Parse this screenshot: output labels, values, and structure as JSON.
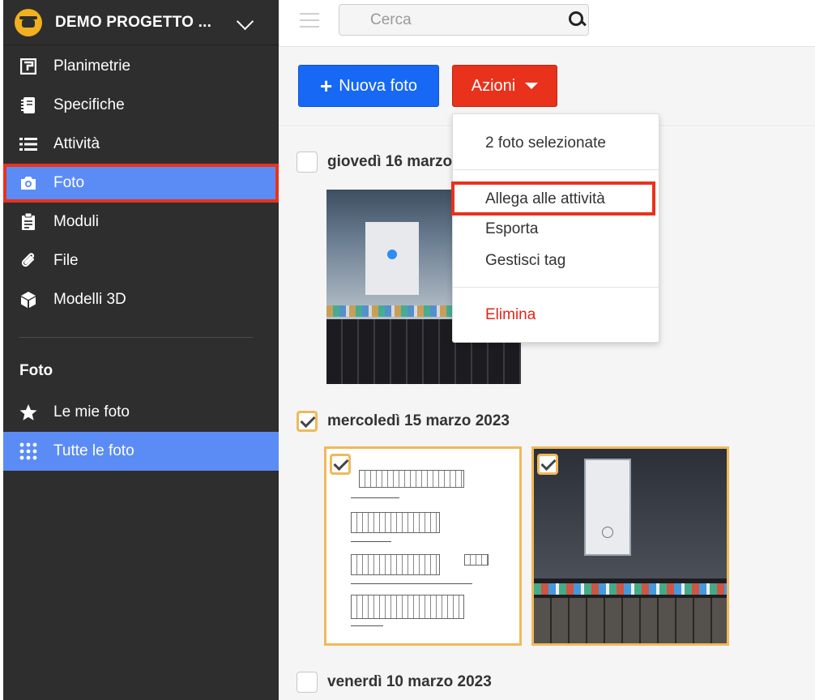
{
  "project": {
    "name": "DEMO PROGETTO ..."
  },
  "sidebar": {
    "items": [
      {
        "label": "Planimetrie",
        "icon": "floorplan-icon"
      },
      {
        "label": "Specifiche",
        "icon": "notebook-icon"
      },
      {
        "label": "Attività",
        "icon": "list-icon"
      },
      {
        "label": "Foto",
        "icon": "camera-icon",
        "active": true
      },
      {
        "label": "Moduli",
        "icon": "clipboard-icon"
      },
      {
        "label": "File",
        "icon": "paperclip-icon"
      },
      {
        "label": "Modelli 3D",
        "icon": "cube-icon"
      }
    ],
    "section_title": "Foto",
    "sub_items": [
      {
        "label": "Le mie foto",
        "icon": "star-icon"
      },
      {
        "label": "Tutte le foto",
        "icon": "grid-dots-icon",
        "active": true
      }
    ]
  },
  "search": {
    "placeholder": "Cerca"
  },
  "toolbar": {
    "new_photo_label": "Nuova foto",
    "actions_label": "Azioni"
  },
  "groups": [
    {
      "title": "giovedì 16 marzo",
      "checked": false
    },
    {
      "title": "mercoledì 15 marzo 2023",
      "checked": true
    },
    {
      "title": "venerdì 10 marzo 2023",
      "checked": false
    }
  ],
  "dropdown": {
    "caption": "2 foto selezionate",
    "items": [
      "Allega alle attività",
      "Esporta",
      "Gestisci tag"
    ],
    "danger_item": "Elimina"
  },
  "colors": {
    "primary": "#1668f5",
    "danger": "#e8321c",
    "sidebar": "#2e2e2e",
    "active": "#5b8cf6",
    "selection": "#f0b95a"
  }
}
